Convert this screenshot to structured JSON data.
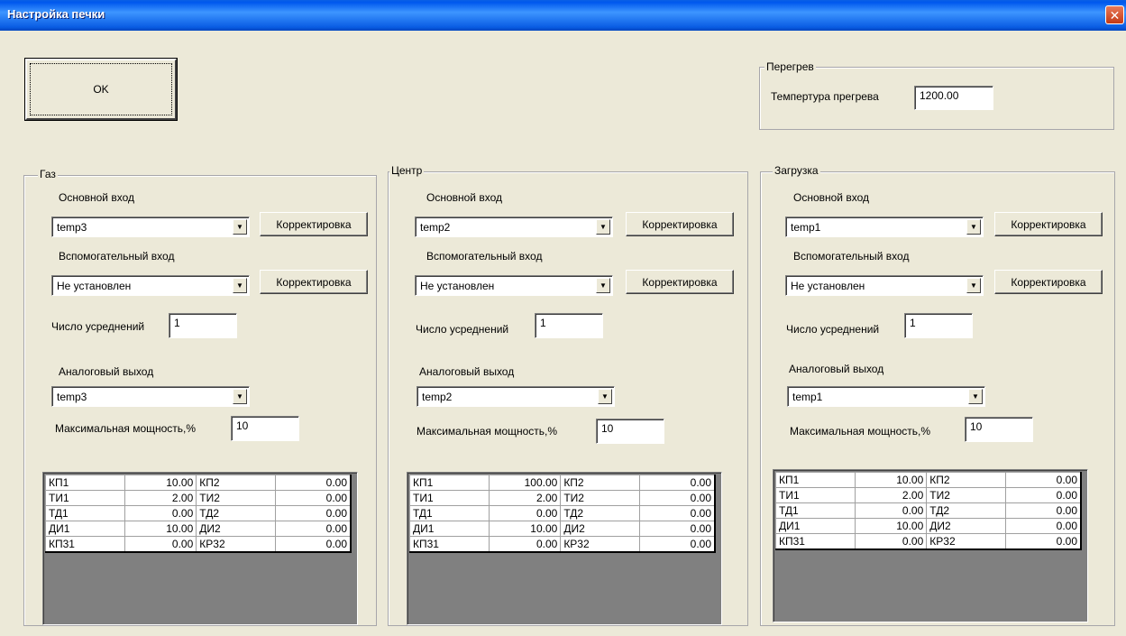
{
  "window": {
    "title": "Настройка печки",
    "close_glyph": "✕"
  },
  "ok_button": {
    "label": "OK"
  },
  "overheat": {
    "group_label": "Перегрев",
    "temp_label": "Темпертура прегрева",
    "temp_value": "1200.00"
  },
  "panels": [
    {
      "group_label": "Газ",
      "main_input_label": "Основной вход",
      "main_input_value": "temp3",
      "correction_label": "Корректировка",
      "aux_input_label": "Вспомогательный вход",
      "aux_input_value": "Не установлен",
      "avg_label": "Число усреднений",
      "avg_value": "1",
      "analog_out_label": "Аналоговый выход",
      "analog_out_value": "temp3",
      "max_power_label": "Максимальная мощность,%",
      "max_power_value": "10",
      "table": [
        [
          "КП1",
          "10.00",
          "КП2",
          "0.00"
        ],
        [
          "ТИ1",
          "2.00",
          "ТИ2",
          "0.00"
        ],
        [
          "ТД1",
          "0.00",
          "ТД2",
          "0.00"
        ],
        [
          "ДИ1",
          "10.00",
          "ДИ2",
          "0.00"
        ],
        [
          "КП31",
          "0.00",
          "КР32",
          "0.00"
        ]
      ]
    },
    {
      "group_label": "Центр",
      "main_input_label": "Основной вход",
      "main_input_value": "temp2",
      "correction_label": "Корректировка",
      "aux_input_label": "Вспомогательный вход",
      "aux_input_value": "Не установлен",
      "avg_label": "Число усреднений",
      "avg_value": "1",
      "analog_out_label": "Аналоговый выход",
      "analog_out_value": "temp2",
      "max_power_label": "Максимальная мощность,%",
      "max_power_value": "10",
      "table": [
        [
          "КП1",
          "100.00",
          "КП2",
          "0.00"
        ],
        [
          "ТИ1",
          "2.00",
          "ТИ2",
          "0.00"
        ],
        [
          "ТД1",
          "0.00",
          "ТД2",
          "0.00"
        ],
        [
          "ДИ1",
          "10.00",
          "ДИ2",
          "0.00"
        ],
        [
          "КП31",
          "0.00",
          "КР32",
          "0.00"
        ]
      ]
    },
    {
      "group_label": "Загрузка",
      "main_input_label": "Основной вход",
      "main_input_value": "temp1",
      "correction_label": "Корректировка",
      "aux_input_label": "Вспомогательный вход",
      "aux_input_value": "Не установлен",
      "avg_label": "Число усреднений",
      "avg_value": "1",
      "analog_out_label": "Аналоговый выход",
      "analog_out_value": "temp1",
      "max_power_label": "Максимальная мощность,%",
      "max_power_value": "10",
      "table": [
        [
          "КП1",
          "10.00",
          "КП2",
          "0.00"
        ],
        [
          "ТИ1",
          "2.00",
          "ТИ2",
          "0.00"
        ],
        [
          "ТД1",
          "0.00",
          "ТД2",
          "0.00"
        ],
        [
          "ДИ1",
          "10.00",
          "ДИ2",
          "0.00"
        ],
        [
          "КП31",
          "0.00",
          "КР32",
          "0.00"
        ]
      ]
    }
  ]
}
